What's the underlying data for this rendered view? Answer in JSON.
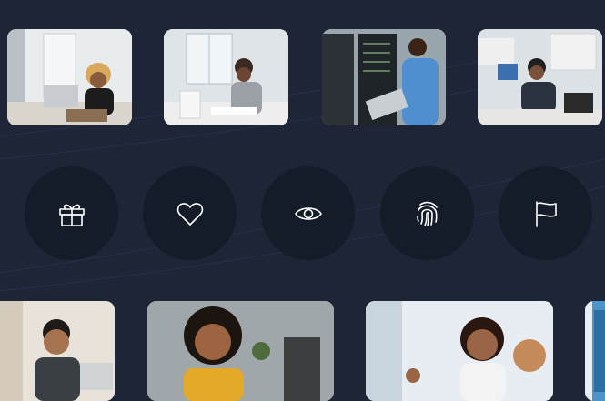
{
  "background_color": "#1d2536",
  "button_color": "#141b29",
  "icon_color": "#ffffff",
  "top_photos": [
    {
      "scene": "woman-on-phone-at-laptop"
    },
    {
      "scene": "woman-reviewing-documents"
    },
    {
      "scene": "man-in-server-room-with-laptop"
    },
    {
      "scene": "man-writing-at-desk"
    }
  ],
  "action_buttons": [
    {
      "icon": "gift-icon"
    },
    {
      "icon": "heart-icon"
    },
    {
      "icon": "eye-icon"
    },
    {
      "icon": "fingerprint-icon"
    },
    {
      "icon": "flag-icon"
    }
  ],
  "bottom_photos": [
    {
      "scene": "man-with-glasses-at-laptop"
    },
    {
      "scene": "smiling-woman-with-glasses"
    },
    {
      "scene": "smiling-woman-in-meeting"
    },
    {
      "scene": "partial-photo"
    }
  ]
}
